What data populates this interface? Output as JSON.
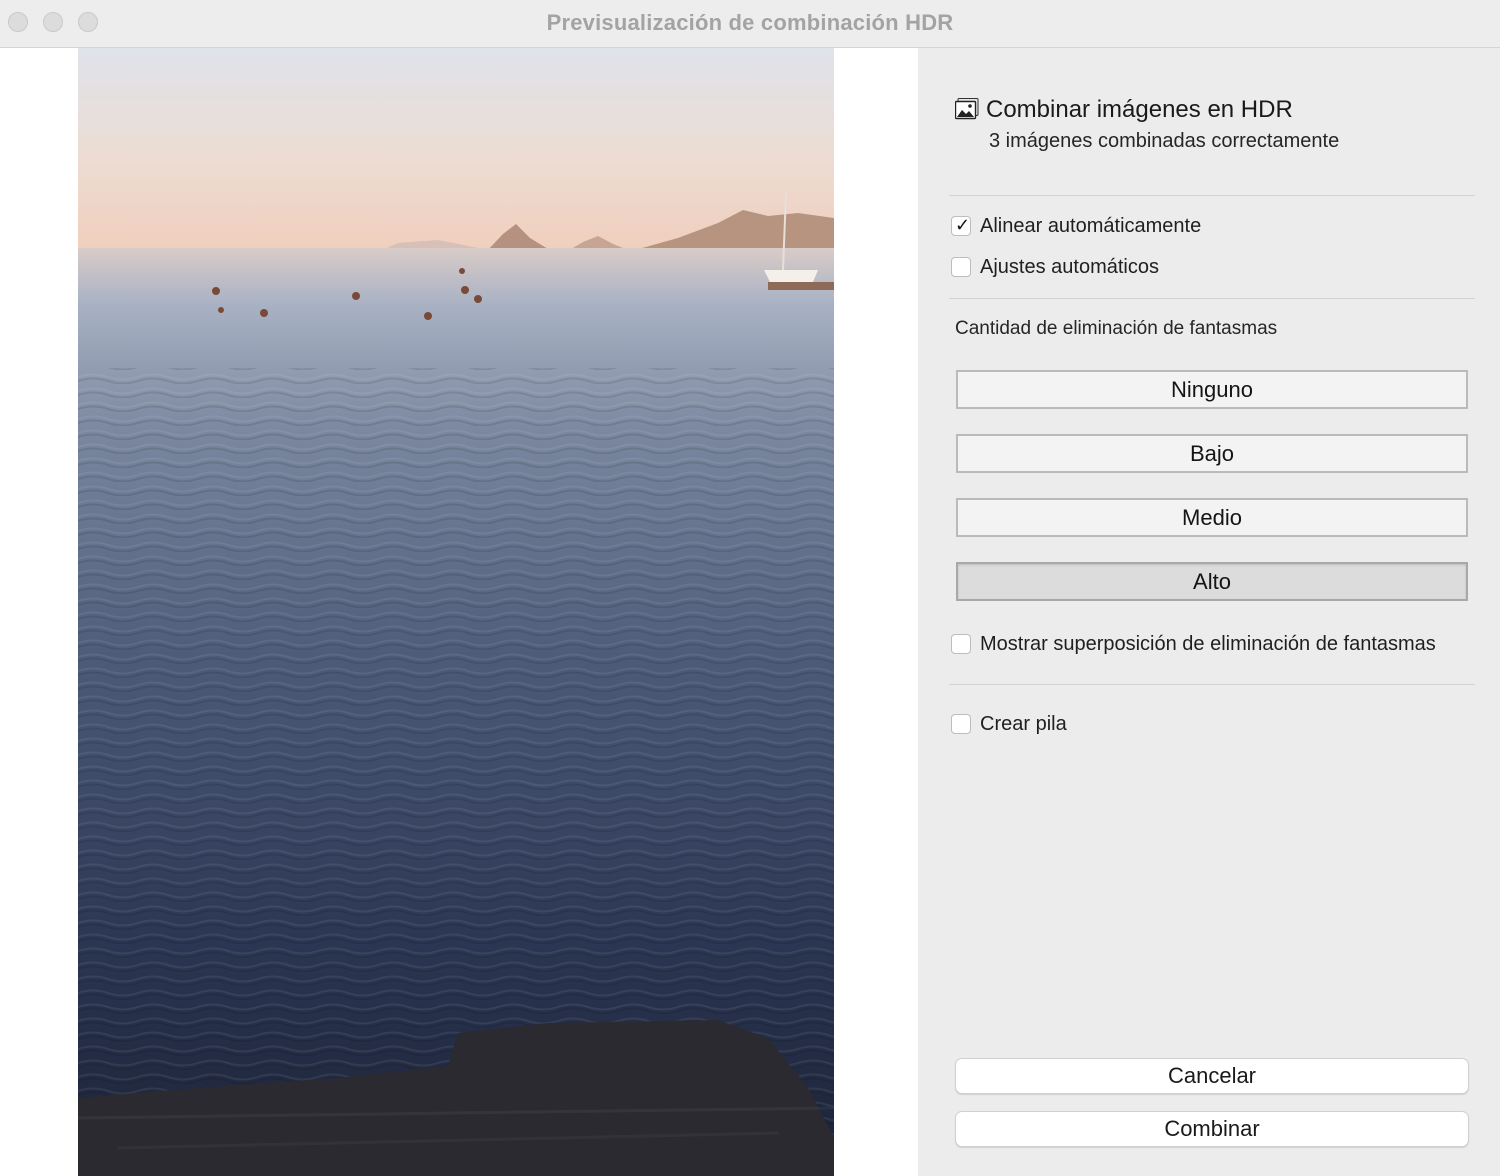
{
  "window": {
    "title": "Previsualización de combinación HDR"
  },
  "header": {
    "icon": "photo-stack-icon",
    "title": "Combinar imágenes en HDR",
    "subtitle": "3 imágenes combinadas correctamente"
  },
  "options": {
    "auto_align": {
      "label": "Alinear automáticamente",
      "checked": true
    },
    "auto_settings": {
      "label": "Ajustes automáticos",
      "checked": false
    }
  },
  "deghost": {
    "label": "Cantidad de eliminación de fantasmas",
    "buttons": [
      {
        "label": "Ninguno",
        "selected": false
      },
      {
        "label": "Bajo",
        "selected": false
      },
      {
        "label": "Medio",
        "selected": false
      },
      {
        "label": "Alto",
        "selected": true
      }
    ],
    "overlay": {
      "label": "Mostrar superposición de eliminación de fantasmas",
      "checked": false
    }
  },
  "stack": {
    "label": "Crear pila",
    "checked": false
  },
  "actions": {
    "cancel": "Cancelar",
    "merge": "Combinar"
  }
}
